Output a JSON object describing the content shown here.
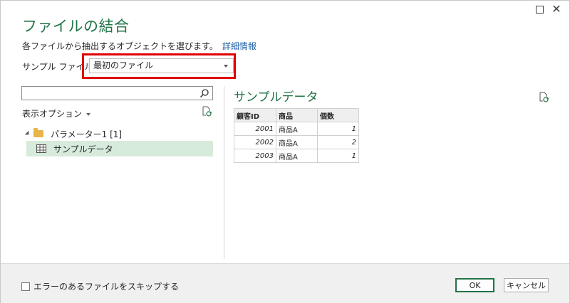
{
  "dialog": {
    "title": "ファイルの結合",
    "subtitle": "各ファイルから抽出するオブジェクトを選びます。",
    "details_link": "詳細情報",
    "sample_file_label": "サンプル ファイル:",
    "sample_file_value": "最初のファイル"
  },
  "navigator": {
    "search_placeholder": "",
    "display_options_label": "表示オプション",
    "tree": [
      {
        "label": "パラメーター1 [1]"
      },
      {
        "label": "サンプルデータ"
      }
    ]
  },
  "preview": {
    "title": "サンプルデータ",
    "columns": [
      "顧客ID",
      "商品",
      "個数"
    ],
    "rows": [
      [
        "2001",
        "商品A",
        "1"
      ],
      [
        "2002",
        "商品A",
        "2"
      ],
      [
        "2003",
        "商品A",
        "1"
      ]
    ]
  },
  "footer": {
    "skip_errors_label": "エラーのあるファイルをスキップする",
    "ok_label": "OK",
    "cancel_label": "キャンセル"
  },
  "icons": {
    "maximize": "maximize-icon",
    "close": "close-icon",
    "search": "search-icon",
    "refresh": "refresh-icon",
    "folder": "folder-icon",
    "table": "table-icon"
  },
  "colors": {
    "accent": "#217346",
    "highlight_border": "#e00000",
    "selected_row": "#d6ebdb",
    "link": "#1e5fa8"
  }
}
